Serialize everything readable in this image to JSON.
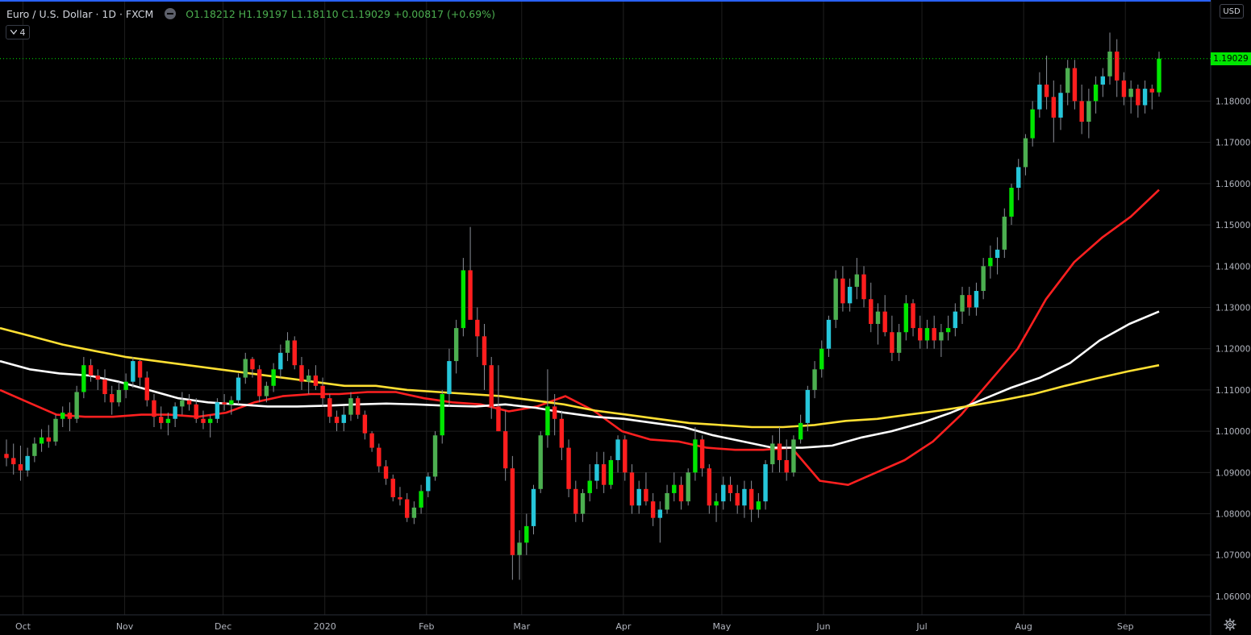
{
  "header": {
    "symbol_title": "Euro / U.S. Dollar · 1D · FXCM",
    "ohlc_text": "O1.18212 H1.19197 L1.18110 C1.19029 +0.00817 (+0.69%)",
    "collapse_badge": "4",
    "currency": "USD",
    "last_price": "1.19029"
  },
  "colors": {
    "up": "#4caf50",
    "up_bright": "#00e600",
    "down": "#ff1e1e",
    "teal": "#26c6da",
    "ma_fast": "#ff2020",
    "ma_mid": "#ffffff",
    "ma_slow": "#ffe033",
    "grid": "#1f1f1f",
    "background": "#000000"
  },
  "icons": {
    "settings": "gear-icon",
    "toggle": "chevron-down-icon"
  },
  "chart_data": {
    "type": "candlestick",
    "title": "Euro / U.S. Dollar · 1D · FXCM",
    "ylim": [
      1.0555,
      1.2045
    ],
    "y_ticks": [
      "1.19029",
      "1.18000",
      "1.17000",
      "1.16000",
      "1.15000",
      "1.14000",
      "1.13000",
      "1.12000",
      "1.11000",
      "1.10000",
      "1.09000",
      "1.08000",
      "1.07000",
      "1.06000"
    ],
    "y_tick_values": [
      1.19029,
      1.18,
      1.17,
      1.16,
      1.15,
      1.14,
      1.13,
      1.12,
      1.11,
      1.1,
      1.09,
      1.08,
      1.07,
      1.06
    ],
    "x_ticks": [
      "Oct",
      "Nov",
      "Dec",
      "2020",
      "Feb",
      "Mar",
      "Apr",
      "May",
      "Jun",
      "Jul",
      "Aug",
      "Sep"
    ],
    "x_tick_dates": [
      "2019-10-01",
      "2019-11-01",
      "2019-12-01",
      "2020-01-01",
      "2020-02-01",
      "2020-03-01",
      "2020-04-01",
      "2020-05-01",
      "2020-06-01",
      "2020-07-01",
      "2020-08-01",
      "2020-09-01"
    ],
    "grid": true,
    "last_price": 1.19029,
    "candles_ohlc": [
      [
        1.0945,
        1.098,
        1.0915,
        1.0935
      ],
      [
        1.0935,
        1.097,
        1.0895,
        1.092
      ],
      [
        1.092,
        1.0965,
        1.088,
        1.0905
      ],
      [
        1.0905,
        1.096,
        1.089,
        1.094
      ],
      [
        1.094,
        1.0985,
        1.0925,
        1.097
      ],
      [
        1.097,
        1.1005,
        1.095,
        1.0985
      ],
      [
        1.0985,
        1.1015,
        1.096,
        1.0975
      ],
      [
        1.0975,
        1.104,
        1.0965,
        1.103
      ],
      [
        1.103,
        1.106,
        1.101,
        1.1045
      ],
      [
        1.1045,
        1.107,
        1.1,
        1.103
      ],
      [
        1.103,
        1.111,
        1.102,
        1.1095
      ],
      [
        1.1095,
        1.118,
        1.108,
        1.116
      ],
      [
        1.116,
        1.1175,
        1.112,
        1.1135
      ],
      [
        1.1135,
        1.115,
        1.11,
        1.1125
      ],
      [
        1.1125,
        1.115,
        1.107,
        1.109
      ],
      [
        1.109,
        1.111,
        1.104,
        1.107
      ],
      [
        1.107,
        1.112,
        1.106,
        1.11
      ],
      [
        1.11,
        1.114,
        1.108,
        1.112
      ],
      [
        1.112,
        1.118,
        1.1105,
        1.117
      ],
      [
        1.117,
        1.1175,
        1.111,
        1.113
      ],
      [
        1.113,
        1.1145,
        1.106,
        1.1075
      ],
      [
        1.1075,
        1.109,
        1.101,
        1.1035
      ],
      [
        1.1035,
        1.106,
        1.1005,
        1.102
      ],
      [
        1.102,
        1.1045,
        1.099,
        1.103
      ],
      [
        1.103,
        1.107,
        1.101,
        1.106
      ],
      [
        1.106,
        1.1095,
        1.104,
        1.1075
      ],
      [
        1.1075,
        1.109,
        1.105,
        1.1065
      ],
      [
        1.1065,
        1.108,
        1.102,
        1.103
      ],
      [
        1.103,
        1.105,
        1.1005,
        1.102
      ],
      [
        1.102,
        1.104,
        1.0985,
        1.103
      ],
      [
        1.103,
        1.108,
        1.102,
        1.107
      ],
      [
        1.107,
        1.109,
        1.105,
        1.1065
      ],
      [
        1.1065,
        1.1085,
        1.104,
        1.1075
      ],
      [
        1.1075,
        1.114,
        1.1065,
        1.113
      ],
      [
        1.113,
        1.119,
        1.1115,
        1.1175
      ],
      [
        1.1175,
        1.118,
        1.113,
        1.115
      ],
      [
        1.115,
        1.116,
        1.107,
        1.1085
      ],
      [
        1.1085,
        1.112,
        1.107,
        1.111
      ],
      [
        1.111,
        1.1165,
        1.1095,
        1.115
      ],
      [
        1.115,
        1.121,
        1.113,
        1.119
      ],
      [
        1.119,
        1.124,
        1.117,
        1.122
      ],
      [
        1.122,
        1.123,
        1.115,
        1.116
      ],
      [
        1.116,
        1.118,
        1.11,
        1.112
      ],
      [
        1.112,
        1.115,
        1.109,
        1.1135
      ],
      [
        1.1135,
        1.116,
        1.11,
        1.111
      ],
      [
        1.111,
        1.113,
        1.106,
        1.108
      ],
      [
        1.108,
        1.109,
        1.102,
        1.1035
      ],
      [
        1.1035,
        1.105,
        1.1,
        1.102
      ],
      [
        1.102,
        1.106,
        1.1,
        1.104
      ],
      [
        1.104,
        1.1095,
        1.1025,
        1.108
      ],
      [
        1.108,
        1.1085,
        1.103,
        1.104
      ],
      [
        1.104,
        1.105,
        1.098,
        1.0995
      ],
      [
        1.0995,
        1.1,
        1.095,
        1.096
      ],
      [
        1.096,
        1.097,
        1.09,
        1.0915
      ],
      [
        1.0915,
        1.093,
        1.087,
        1.0885
      ],
      [
        1.0885,
        1.0895,
        1.083,
        1.084
      ],
      [
        1.084,
        1.0865,
        1.082,
        1.0835
      ],
      [
        1.0835,
        1.085,
        1.078,
        1.079
      ],
      [
        1.079,
        1.083,
        1.0775,
        1.0815
      ],
      [
        1.0815,
        1.087,
        1.08,
        1.0855
      ],
      [
        1.0855,
        1.09,
        1.084,
        1.089
      ],
      [
        1.089,
        1.1,
        1.088,
        1.099
      ],
      [
        1.099,
        1.11,
        1.097,
        1.109
      ],
      [
        1.109,
        1.12,
        1.106,
        1.117
      ],
      [
        1.117,
        1.127,
        1.114,
        1.125
      ],
      [
        1.125,
        1.142,
        1.123,
        1.139
      ],
      [
        1.139,
        1.1495,
        1.135,
        1.127
      ],
      [
        1.127,
        1.13,
        1.118,
        1.123
      ],
      [
        1.123,
        1.126,
        1.11,
        1.116
      ],
      [
        1.116,
        1.118,
        1.103,
        1.106
      ],
      [
        1.106,
        1.116,
        1.1,
        1.1
      ],
      [
        1.1,
        1.105,
        1.088,
        1.091
      ],
      [
        1.091,
        1.094,
        1.064,
        1.07
      ],
      [
        1.07,
        1.076,
        1.064,
        1.073
      ],
      [
        1.073,
        1.08,
        1.07,
        1.077
      ],
      [
        1.077,
        1.087,
        1.075,
        1.086
      ],
      [
        1.086,
        1.1,
        1.085,
        1.099
      ],
      [
        1.099,
        1.115,
        1.096,
        1.106
      ],
      [
        1.106,
        1.109,
        1.099,
        1.103
      ],
      [
        1.103,
        1.105,
        1.093,
        1.096
      ],
      [
        1.096,
        1.098,
        1.084,
        1.086
      ],
      [
        1.086,
        1.088,
        1.078,
        1.08
      ],
      [
        1.08,
        1.086,
        1.078,
        1.085
      ],
      [
        1.085,
        1.092,
        1.083,
        1.088
      ],
      [
        1.088,
        1.095,
        1.086,
        1.092
      ],
      [
        1.092,
        1.095,
        1.085,
        1.087
      ],
      [
        1.087,
        1.094,
        1.086,
        1.093
      ],
      [
        1.093,
        1.099,
        1.09,
        1.098
      ],
      [
        1.098,
        1.099,
        1.088,
        1.09
      ],
      [
        1.09,
        1.092,
        1.08,
        1.082
      ],
      [
        1.082,
        1.088,
        1.08,
        1.086
      ],
      [
        1.086,
        1.09,
        1.082,
        1.083
      ],
      [
        1.083,
        1.085,
        1.077,
        1.079
      ],
      [
        1.079,
        1.083,
        1.073,
        1.081
      ],
      [
        1.081,
        1.087,
        1.08,
        1.085
      ],
      [
        1.085,
        1.09,
        1.083,
        1.087
      ],
      [
        1.087,
        1.089,
        1.081,
        1.083
      ],
      [
        1.083,
        1.091,
        1.082,
        1.09
      ],
      [
        1.09,
        1.101,
        1.088,
        1.098
      ],
      [
        1.098,
        1.099,
        1.089,
        1.091
      ],
      [
        1.091,
        1.092,
        1.08,
        1.082
      ],
      [
        1.082,
        1.085,
        1.078,
        1.083
      ],
      [
        1.083,
        1.089,
        1.081,
        1.087
      ],
      [
        1.087,
        1.089,
        1.083,
        1.085
      ],
      [
        1.085,
        1.087,
        1.08,
        1.082
      ],
      [
        1.082,
        1.088,
        1.079,
        1.086
      ],
      [
        1.086,
        1.088,
        1.078,
        1.081
      ],
      [
        1.081,
        1.085,
        1.079,
        1.083
      ],
      [
        1.083,
        1.093,
        1.081,
        1.092
      ],
      [
        1.092,
        1.099,
        1.09,
        1.097
      ],
      [
        1.097,
        1.101,
        1.09,
        1.093
      ],
      [
        1.093,
        1.098,
        1.088,
        1.09
      ],
      [
        1.09,
        1.099,
        1.089,
        1.098
      ],
      [
        1.098,
        1.104,
        1.097,
        1.102
      ],
      [
        1.102,
        1.111,
        1.1,
        1.11
      ],
      [
        1.11,
        1.117,
        1.108,
        1.115
      ],
      [
        1.115,
        1.122,
        1.113,
        1.12
      ],
      [
        1.12,
        1.128,
        1.118,
        1.127
      ],
      [
        1.127,
        1.139,
        1.125,
        1.137
      ],
      [
        1.137,
        1.14,
        1.129,
        1.131
      ],
      [
        1.131,
        1.137,
        1.129,
        1.135
      ],
      [
        1.135,
        1.142,
        1.132,
        1.138
      ],
      [
        1.138,
        1.14,
        1.13,
        1.132
      ],
      [
        1.132,
        1.136,
        1.124,
        1.126
      ],
      [
        1.126,
        1.131,
        1.121,
        1.129
      ],
      [
        1.129,
        1.133,
        1.123,
        1.124
      ],
      [
        1.124,
        1.128,
        1.117,
        1.119
      ],
      [
        1.119,
        1.126,
        1.117,
        1.124
      ],
      [
        1.124,
        1.133,
        1.122,
        1.131
      ],
      [
        1.131,
        1.132,
        1.123,
        1.125
      ],
      [
        1.125,
        1.128,
        1.12,
        1.122
      ],
      [
        1.122,
        1.127,
        1.12,
        1.125
      ],
      [
        1.125,
        1.128,
        1.12,
        1.122
      ],
      [
        1.122,
        1.126,
        1.118,
        1.124
      ],
      [
        1.124,
        1.128,
        1.122,
        1.125
      ],
      [
        1.125,
        1.131,
        1.123,
        1.129
      ],
      [
        1.129,
        1.135,
        1.126,
        1.133
      ],
      [
        1.133,
        1.135,
        1.128,
        1.13
      ],
      [
        1.13,
        1.136,
        1.128,
        1.134
      ],
      [
        1.134,
        1.142,
        1.132,
        1.14
      ],
      [
        1.14,
        1.145,
        1.137,
        1.142
      ],
      [
        1.142,
        1.147,
        1.138,
        1.144
      ],
      [
        1.144,
        1.154,
        1.142,
        1.152
      ],
      [
        1.152,
        1.16,
        1.15,
        1.159
      ],
      [
        1.159,
        1.166,
        1.156,
        1.164
      ],
      [
        1.164,
        1.172,
        1.162,
        1.171
      ],
      [
        1.171,
        1.18,
        1.169,
        1.178
      ],
      [
        1.178,
        1.187,
        1.176,
        1.184
      ],
      [
        1.184,
        1.191,
        1.178,
        1.181
      ],
      [
        1.181,
        1.185,
        1.17,
        1.176
      ],
      [
        1.176,
        1.184,
        1.173,
        1.182
      ],
      [
        1.182,
        1.19,
        1.179,
        1.188
      ],
      [
        1.188,
        1.19,
        1.178,
        1.18
      ],
      [
        1.18,
        1.184,
        1.172,
        1.175
      ],
      [
        1.175,
        1.183,
        1.171,
        1.18
      ],
      [
        1.18,
        1.186,
        1.177,
        1.184
      ],
      [
        1.184,
        1.188,
        1.181,
        1.186
      ],
      [
        1.186,
        1.1966,
        1.184,
        1.192
      ],
      [
        1.192,
        1.195,
        1.181,
        1.185
      ],
      [
        1.185,
        1.187,
        1.179,
        1.181
      ],
      [
        1.181,
        1.185,
        1.177,
        1.183
      ],
      [
        1.183,
        1.184,
        1.176,
        1.179
      ],
      [
        1.179,
        1.185,
        1.177,
        1.183
      ],
      [
        1.183,
        1.184,
        1.178,
        1.1821
      ],
      [
        1.18212,
        1.19197,
        1.1811,
        1.19029
      ]
    ],
    "series": [
      {
        "name": "",
        "color": "#ff2020",
        "values": [
          1.11,
          1.107,
          1.104,
          1.1035,
          1.1035,
          1.104,
          1.104,
          1.1035,
          1.1045,
          1.107,
          1.1085,
          1.109,
          1.109,
          1.1095,
          1.1095,
          1.108,
          1.107,
          1.1065,
          1.1048,
          1.106,
          1.1085,
          1.105,
          1.1,
          1.098,
          1.0975,
          1.096,
          1.0955,
          1.0955,
          1.096,
          1.088,
          1.087,
          1.09,
          1.093,
          1.0975,
          1.104,
          1.112,
          1.12,
          1.132,
          1.141,
          1.147,
          1.152,
          1.1585
        ]
      },
      {
        "name": "",
        "color": "#ffffff",
        "values": [
          1.117,
          1.115,
          1.114,
          1.1135,
          1.112,
          1.11,
          1.108,
          1.107,
          1.1065,
          1.106,
          1.106,
          1.1062,
          1.1065,
          1.1067,
          1.1065,
          1.1062,
          1.106,
          1.1065,
          1.1057,
          1.1045,
          1.1035,
          1.103,
          1.102,
          1.101,
          1.099,
          1.0975,
          1.096,
          1.096,
          1.0965,
          1.0985,
          1.1,
          1.102,
          1.1045,
          1.1075,
          1.1105,
          1.113,
          1.1165,
          1.122,
          1.126,
          1.129
        ]
      },
      {
        "name": "",
        "color": "#ffe033",
        "values": [
          1.125,
          1.123,
          1.121,
          1.1195,
          1.118,
          1.117,
          1.116,
          1.115,
          1.114,
          1.113,
          1.112,
          1.111,
          1.111,
          1.11,
          1.1095,
          1.109,
          1.1085,
          1.1075,
          1.1065,
          1.105,
          1.104,
          1.103,
          1.102,
          1.1015,
          1.101,
          1.101,
          1.1015,
          1.1025,
          1.103,
          1.104,
          1.105,
          1.1062,
          1.1075,
          1.109,
          1.111,
          1.1128,
          1.1145,
          1.116
        ]
      }
    ]
  }
}
